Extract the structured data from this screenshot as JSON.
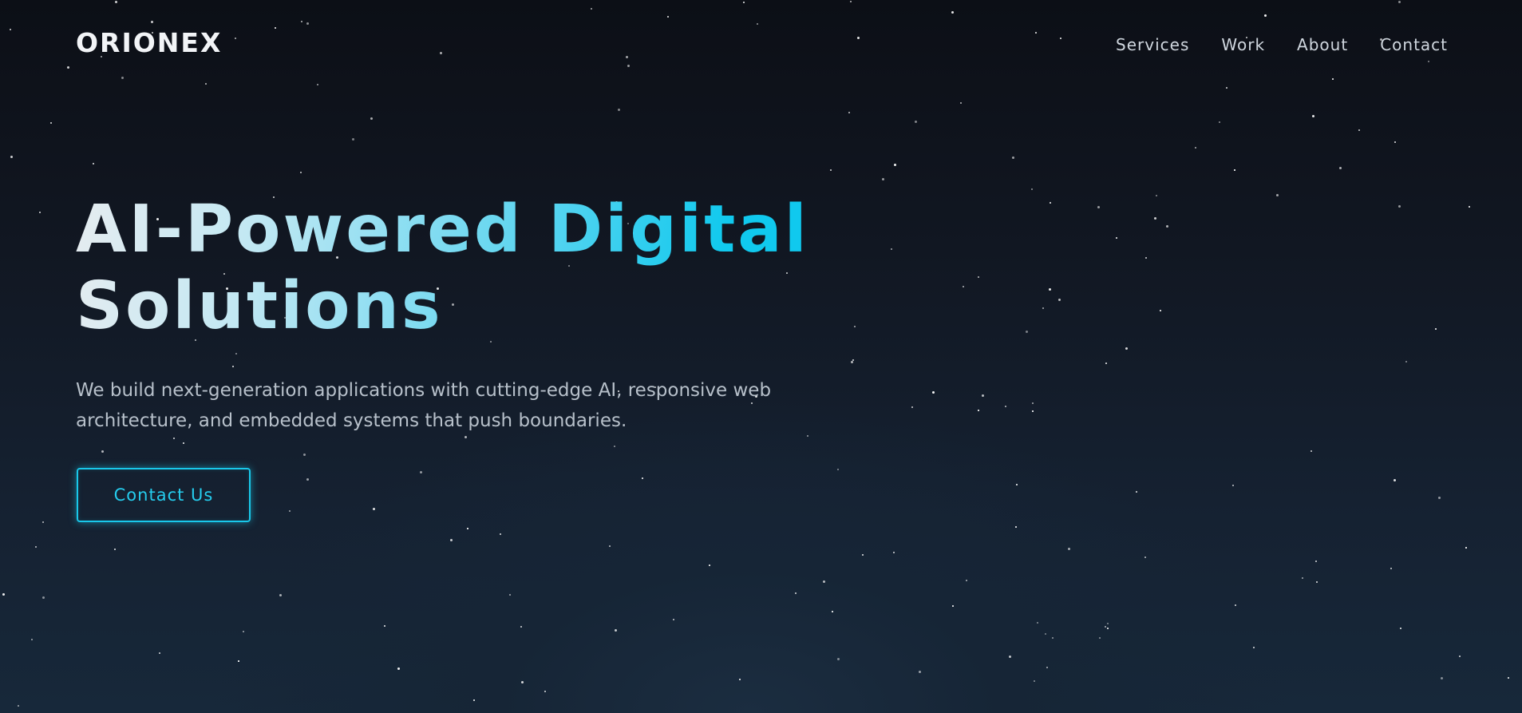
{
  "brand": {
    "name": "ORIONEX"
  },
  "nav": {
    "items": [
      {
        "label": "Services"
      },
      {
        "label": "Work"
      },
      {
        "label": "About"
      },
      {
        "label": "Contact"
      }
    ]
  },
  "hero": {
    "title_line1": "AI-Powered Digital",
    "title_line2": "Solutions",
    "subtitle": "We build next-generation applications with cutting-edge AI, responsive web architecture, and embedded systems that push boundaries.",
    "cta_label": "Contact Us"
  },
  "theme": {
    "accent": "#19c8ea",
    "background_top": "#0c0f16",
    "background_bottom": "#17283a",
    "text_primary": "#f2f4f7",
    "text_secondary": "#b7c0ca"
  }
}
